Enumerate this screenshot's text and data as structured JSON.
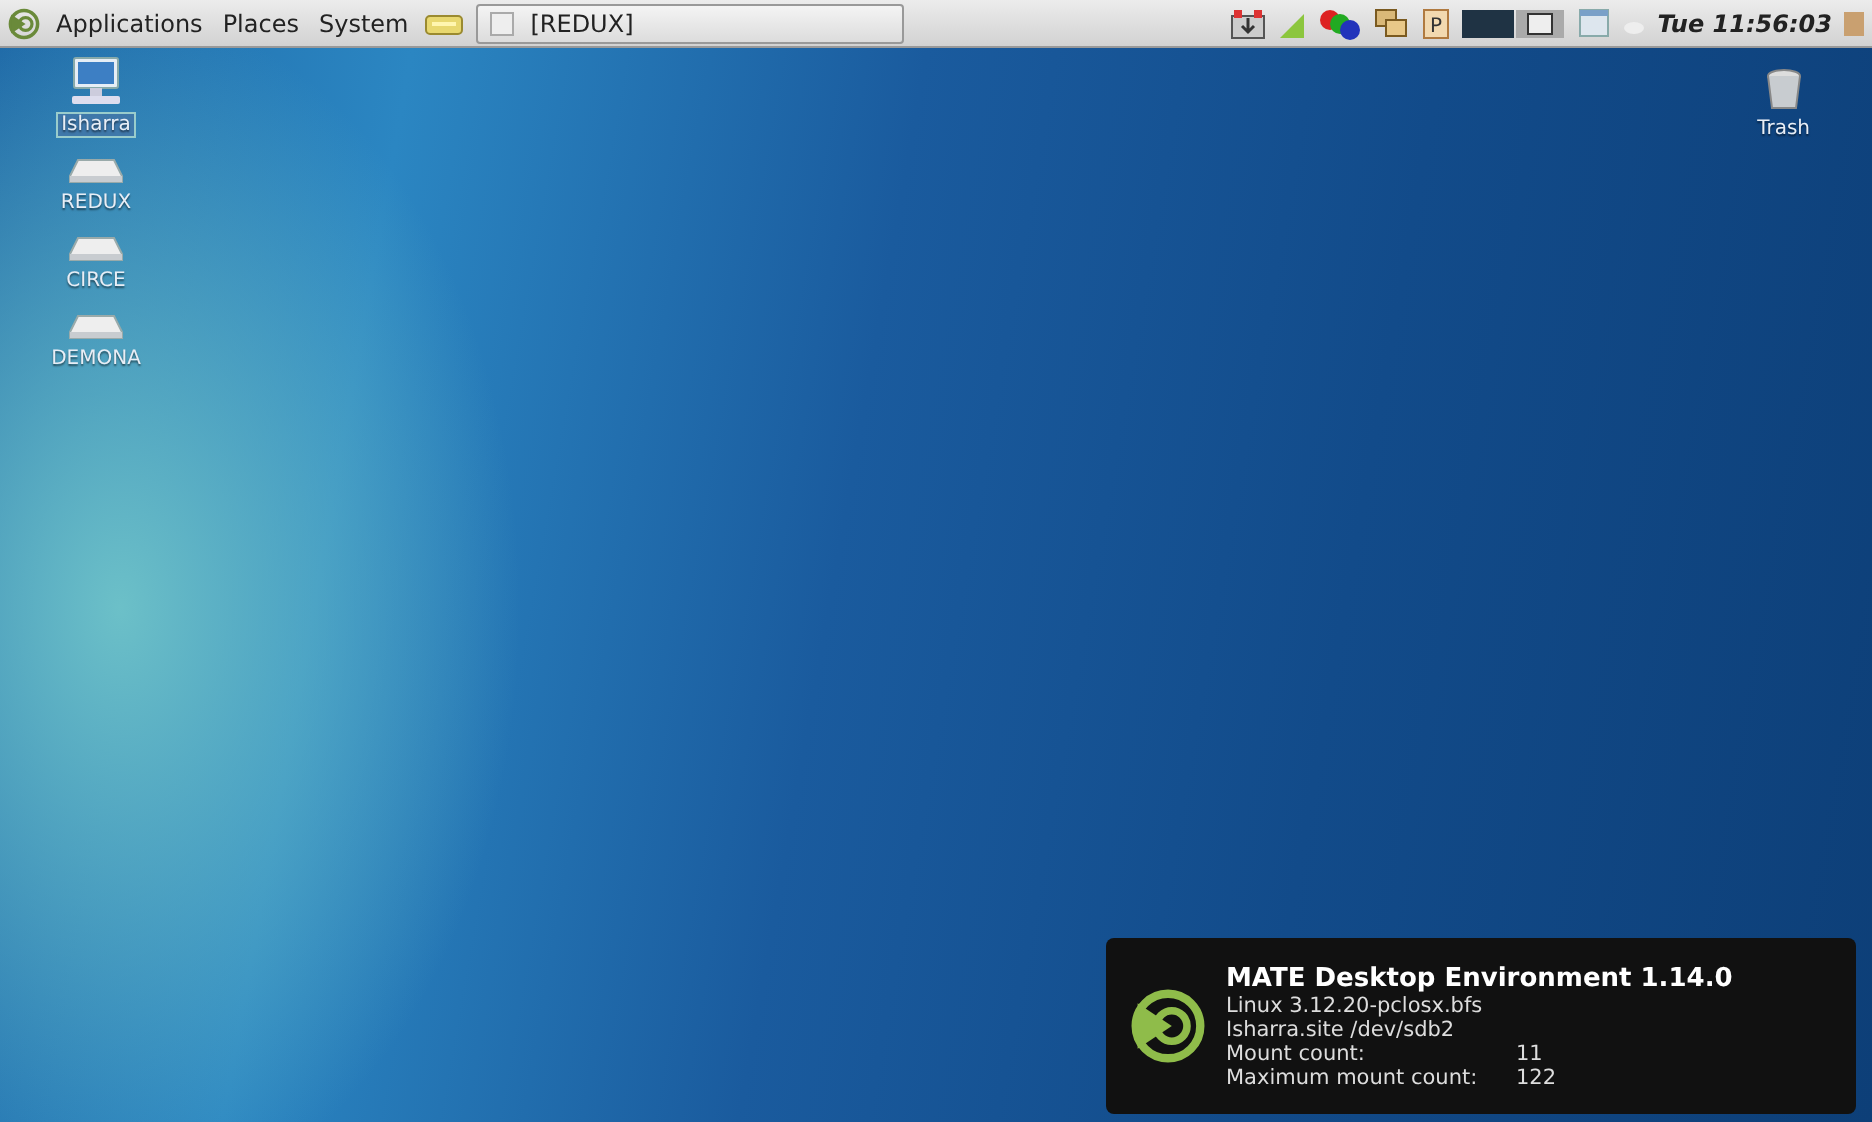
{
  "panel": {
    "menus": [
      "Applications",
      "Places",
      "System"
    ],
    "window_button": {
      "label": "[REDUX]",
      "selected": false
    },
    "tray_badge": "P",
    "clock": "Tue 11:56:03"
  },
  "desktop_icons": [
    {
      "label": "Isharra",
      "kind": "computer",
      "selected": true
    },
    {
      "label": "REDUX",
      "kind": "drive",
      "selected": false
    },
    {
      "label": "CIRCE",
      "kind": "drive",
      "selected": false
    },
    {
      "label": "DEMONA",
      "kind": "drive",
      "selected": false
    }
  ],
  "trash": {
    "label": "Trash"
  },
  "conky": {
    "title": "MATE Desktop Environment 1.14.0",
    "lines": [
      {
        "label": "Linux 3.12.20-pclosx.bfs"
      },
      {
        "label": "Isharra.site  /dev/sdb2"
      },
      {
        "label": "Mount count:",
        "value": "11"
      },
      {
        "label": "Maximum mount count:",
        "value": "122"
      }
    ]
  }
}
